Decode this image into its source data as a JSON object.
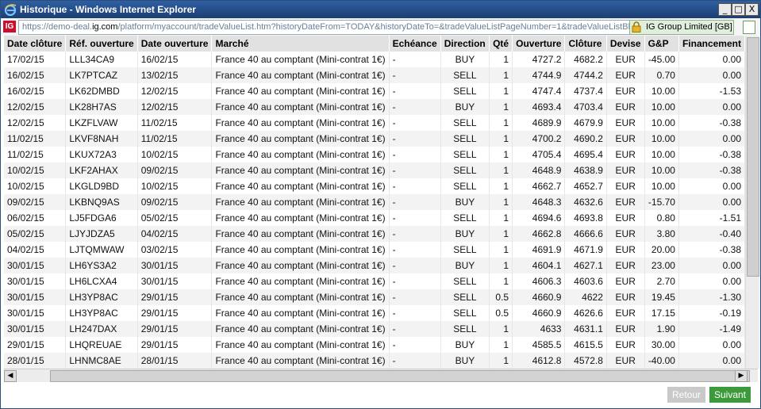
{
  "window": {
    "title": "Historique - Windows Internet Explorer",
    "buttons": {
      "minimize": "_",
      "maximize": "□",
      "close": "X"
    }
  },
  "address": {
    "url_prefix": "https://demo-deal.",
    "url_domain": "ig.com",
    "url_suffix": "/platform/myaccount/tradeValueList.htm?historyDateFrom=TODAY&historyDateTo=&tradeValueListPageNumber=1&tradeValueListBl",
    "security_label": "IG Group Limited [GB]",
    "logo_text": "IG"
  },
  "table": {
    "headers": [
      "Date clôture",
      "Réf. ouverture",
      "Date ouverture",
      "Marché",
      "Echéance",
      "Direction",
      "Qté",
      "Ouverture",
      "Clôture",
      "Devise",
      "G&P",
      "Financement"
    ],
    "rows": [
      [
        "17/02/15",
        "LLL34CA9",
        "16/02/15",
        "France 40 au comptant (Mini-contrat 1€)",
        "-",
        "BUY",
        "1",
        "4727.2",
        "4682.2",
        "EUR",
        "-45.00",
        "0.00"
      ],
      [
        "16/02/15",
        "LK7PTCAZ",
        "13/02/15",
        "France 40 au comptant (Mini-contrat 1€)",
        "-",
        "SELL",
        "1",
        "4744.9",
        "4744.2",
        "EUR",
        "0.70",
        "0.00"
      ],
      [
        "16/02/15",
        "LK62DMBD",
        "12/02/15",
        "France 40 au comptant (Mini-contrat 1€)",
        "-",
        "SELL",
        "1",
        "4747.4",
        "4737.4",
        "EUR",
        "10.00",
        "-1.53"
      ],
      [
        "12/02/15",
        "LK28H7AS",
        "12/02/15",
        "France 40 au comptant (Mini-contrat 1€)",
        "-",
        "BUY",
        "1",
        "4693.4",
        "4703.4",
        "EUR",
        "10.00",
        "0.00"
      ],
      [
        "12/02/15",
        "LKZFLVAW",
        "11/02/15",
        "France 40 au comptant (Mini-contrat 1€)",
        "-",
        "SELL",
        "1",
        "4689.9",
        "4679.9",
        "EUR",
        "10.00",
        "-0.38"
      ],
      [
        "11/02/15",
        "LKVF8NAH",
        "11/02/15",
        "France 40 au comptant (Mini-contrat 1€)",
        "-",
        "SELL",
        "1",
        "4700.2",
        "4690.2",
        "EUR",
        "10.00",
        "0.00"
      ],
      [
        "11/02/15",
        "LKUX72A3",
        "10/02/15",
        "France 40 au comptant (Mini-contrat 1€)",
        "-",
        "SELL",
        "1",
        "4705.4",
        "4695.4",
        "EUR",
        "10.00",
        "-0.38"
      ],
      [
        "10/02/15",
        "LKF2AHAX",
        "09/02/15",
        "France 40 au comptant (Mini-contrat 1€)",
        "-",
        "SELL",
        "1",
        "4648.9",
        "4638.9",
        "EUR",
        "10.00",
        "-0.38"
      ],
      [
        "10/02/15",
        "LKGLD9BD",
        "10/02/15",
        "France 40 au comptant (Mini-contrat 1€)",
        "-",
        "SELL",
        "1",
        "4662.7",
        "4652.7",
        "EUR",
        "10.00",
        "0.00"
      ],
      [
        "09/02/15",
        "LKBNQ9AS",
        "09/02/15",
        "France 40 au comptant (Mini-contrat 1€)",
        "-",
        "BUY",
        "1",
        "4648.3",
        "4632.6",
        "EUR",
        "-15.70",
        "0.00"
      ],
      [
        "06/02/15",
        "LJ5FDGA6",
        "05/02/15",
        "France 40 au comptant (Mini-contrat 1€)",
        "-",
        "SELL",
        "1",
        "4694.6",
        "4693.8",
        "EUR",
        "0.80",
        "-1.51"
      ],
      [
        "05/02/15",
        "LJYJDZA5",
        "04/02/15",
        "France 40 au comptant (Mini-contrat 1€)",
        "-",
        "BUY",
        "1",
        "4662.8",
        "4666.6",
        "EUR",
        "3.80",
        "-0.40"
      ],
      [
        "04/02/15",
        "LJTQMWAW",
        "03/02/15",
        "France 40 au comptant (Mini-contrat 1€)",
        "-",
        "SELL",
        "1",
        "4691.9",
        "4671.9",
        "EUR",
        "20.00",
        "-0.38"
      ],
      [
        "30/01/15",
        "LH6YS3A2",
        "30/01/15",
        "France 40 au comptant (Mini-contrat 1€)",
        "-",
        "BUY",
        "1",
        "4604.1",
        "4627.1",
        "EUR",
        "23.00",
        "0.00"
      ],
      [
        "30/01/15",
        "LH6LCXA4",
        "30/01/15",
        "France 40 au comptant (Mini-contrat 1€)",
        "-",
        "SELL",
        "1",
        "4606.3",
        "4603.6",
        "EUR",
        "2.70",
        "0.00"
      ],
      [
        "30/01/15",
        "LH3YP8AC",
        "29/01/15",
        "France 40 au comptant (Mini-contrat 1€)",
        "-",
        "SELL",
        "0.5",
        "4660.9",
        "4622",
        "EUR",
        "19.45",
        "-1.30"
      ],
      [
        "30/01/15",
        "LH3YP8AC",
        "29/01/15",
        "France 40 au comptant (Mini-contrat 1€)",
        "-",
        "SELL",
        "0.5",
        "4660.9",
        "4626.6",
        "EUR",
        "17.15",
        "-0.19"
      ],
      [
        "30/01/15",
        "LH247DAX",
        "29/01/15",
        "France 40 au comptant (Mini-contrat 1€)",
        "-",
        "SELL",
        "1",
        "4633",
        "4631.1",
        "EUR",
        "1.90",
        "-1.49"
      ],
      [
        "29/01/15",
        "LHQREUAE",
        "29/01/15",
        "France 40 au comptant (Mini-contrat 1€)",
        "-",
        "BUY",
        "1",
        "4585.5",
        "4615.5",
        "EUR",
        "30.00",
        "0.00"
      ],
      [
        "28/01/15",
        "LHNMC8AE",
        "28/01/15",
        "France 40 au comptant (Mini-contrat 1€)",
        "-",
        "BUY",
        "1",
        "4612.8",
        "4572.8",
        "EUR",
        "-40.00",
        "0.00"
      ]
    ]
  },
  "footer": {
    "back_label": "Retour",
    "next_label": "Suivant"
  },
  "colors": {
    "titlebar": "#1c3f74",
    "header_bg": "#e1e1e1",
    "next_button": "#3d9a3a",
    "back_button": "#c9c9c9",
    "ig_red": "#c8102e"
  }
}
